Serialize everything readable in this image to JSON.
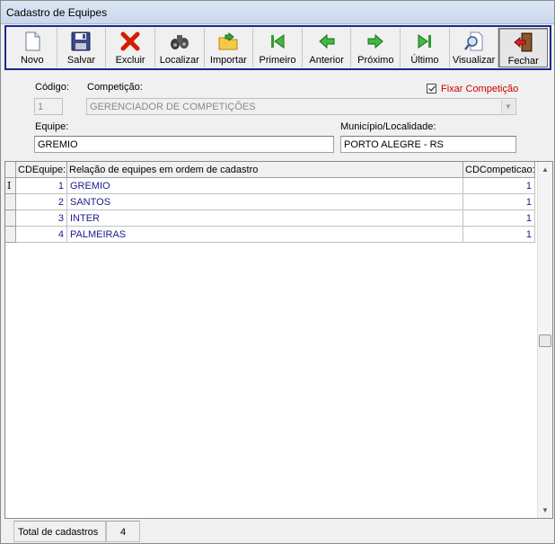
{
  "window": {
    "title": "Cadastro de Equipes"
  },
  "toolbar": {
    "buttons": [
      {
        "label": "Novo",
        "icon": "new-document-icon"
      },
      {
        "label": "Salvar",
        "icon": "floppy-disk-icon"
      },
      {
        "label": "Excluir",
        "icon": "red-x-icon"
      },
      {
        "label": "Localizar",
        "icon": "binoculars-icon"
      },
      {
        "label": "Importar",
        "icon": "import-folder-icon"
      },
      {
        "label": "Primeiro",
        "icon": "first-record-icon"
      },
      {
        "label": "Anterior",
        "icon": "previous-record-icon"
      },
      {
        "label": "Próximo",
        "icon": "next-record-icon"
      },
      {
        "label": "Último",
        "icon": "last-record-icon"
      },
      {
        "label": "Visualizar",
        "icon": "magnifier-document-icon"
      },
      {
        "label": "Fechar",
        "icon": "exit-door-icon"
      }
    ]
  },
  "form": {
    "codigo_label": "Código:",
    "codigo_value": "1",
    "competicao_label": "Competição:",
    "competicao_value": "GERENCIADOR DE COMPETIÇÕES",
    "fixar_label": "Fixar Competição",
    "fixar_checked": true,
    "equipe_label": "Equipe:",
    "equipe_value": "GREMIO",
    "municipio_label": "Município/Localidade:",
    "municipio_value": "PORTO  ALEGRE - RS"
  },
  "grid": {
    "columns": [
      "CDEquipe:",
      "Relação de equipes em ordem de cadastro",
      "CDCompeticao:"
    ],
    "rows": [
      {
        "cd": "1",
        "nome": "GREMIO",
        "comp": "1"
      },
      {
        "cd": "2",
        "nome": "SANTOS",
        "comp": "1"
      },
      {
        "cd": "3",
        "nome": "INTER",
        "comp": "1"
      },
      {
        "cd": "4",
        "nome": "PALMEIRAS",
        "comp": "1"
      }
    ],
    "current_row_marker": "I"
  },
  "status": {
    "total_label": "Total de cadastros",
    "total_value": "4"
  },
  "colors": {
    "toolbar_border": "#1a2a8c",
    "grid_text": "#1c1c8c",
    "fixar_text": "#cc0000"
  }
}
